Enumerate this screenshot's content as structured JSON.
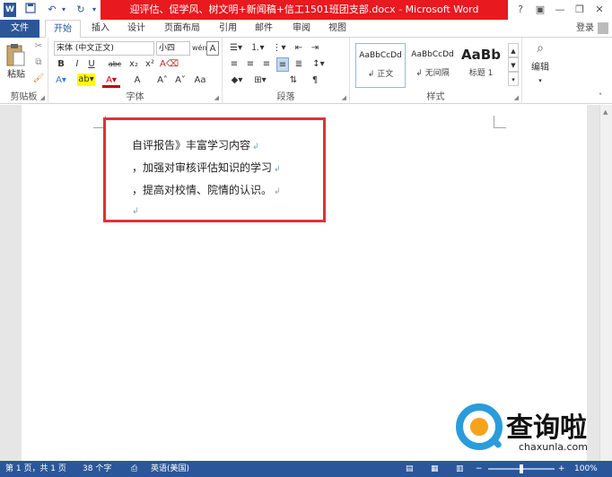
{
  "app": {
    "title": "迎评估、促学风、树文明+新闻稿+信工1501班团支部.docx - Microsoft Word",
    "help": "?",
    "sign_in": "登录"
  },
  "tabs": [
    {
      "label": "文件"
    },
    {
      "label": "开始"
    },
    {
      "label": "插入"
    },
    {
      "label": "设计"
    },
    {
      "label": "页面布局"
    },
    {
      "label": "引用"
    },
    {
      "label": "邮件"
    },
    {
      "label": "审阅"
    },
    {
      "label": "视图"
    }
  ],
  "ribbon": {
    "clipboard": {
      "paste_label": "粘贴",
      "group_label": "剪贴板"
    },
    "font": {
      "font_name": "宋体 (中文正文)",
      "font_size": "小四",
      "bold": "B",
      "italic": "I",
      "underline": "U",
      "strike": "abc",
      "subscript": "x₂",
      "superscript": "x²",
      "grow": "A˄",
      "shrink": "A˅",
      "case": "Aa",
      "group_label": "字体"
    },
    "paragraph": {
      "group_label": "段落"
    },
    "styles": {
      "items": [
        {
          "preview": "AaBbCcDd",
          "name": "↲ 正文"
        },
        {
          "preview": "AaBbCcDd",
          "name": "↲ 无间隔"
        },
        {
          "preview": "AaBb",
          "name": "标题 1"
        }
      ],
      "group_label": "样式"
    },
    "editing": {
      "label": "编辑"
    }
  },
  "document": {
    "lines": [
      "自评报告》丰富学习内容",
      "，加强对审核评估知识的学习",
      "，提高对校情、院情的认识。"
    ]
  },
  "status": {
    "page": "第 1 页，共 1 页",
    "words": "38 个字",
    "language": "英语(美国)",
    "zoom": "100%"
  },
  "watermark": {
    "name": "查询啦",
    "url": "chaxunla.com"
  },
  "colors": {
    "accent": "#2b579a",
    "title_highlight": "#e8191f",
    "annotation_box": "#e0303b"
  }
}
